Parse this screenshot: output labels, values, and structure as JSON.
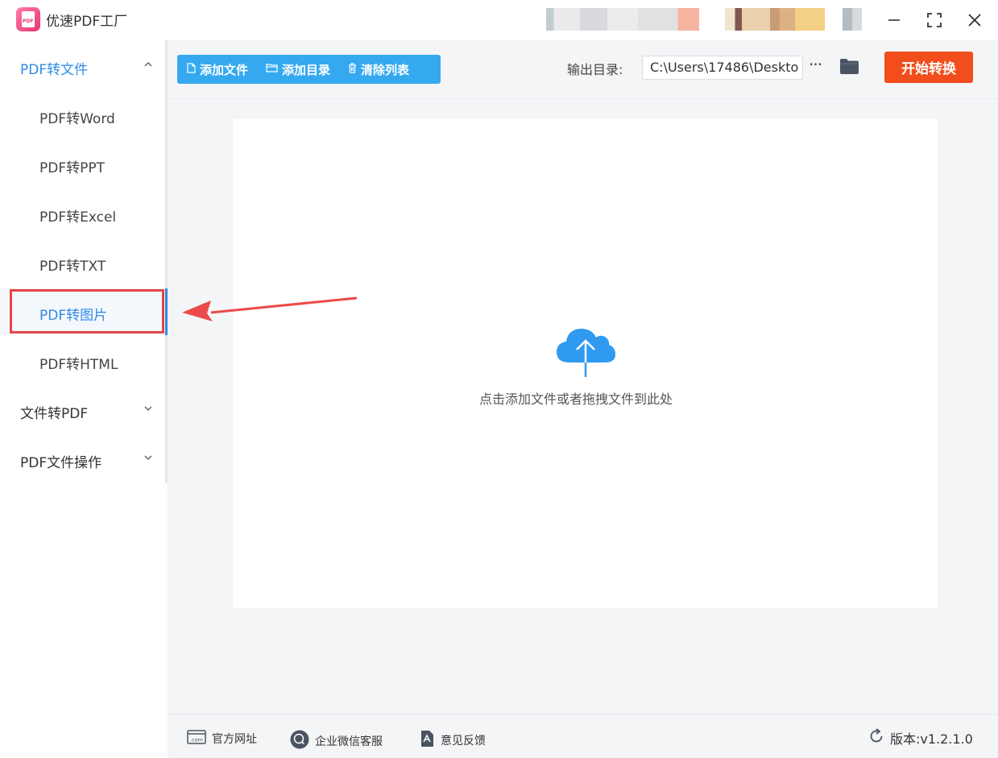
{
  "app": {
    "title": "优速PDF工厂",
    "logo_text": "PDF"
  },
  "window": {
    "controls": [
      "minimize-icon",
      "maximize-icon",
      "close-icon"
    ]
  },
  "sidebar": {
    "groups": [
      {
        "label": "PDF转文件",
        "expanded": true
      },
      {
        "label": "文件转PDF",
        "expanded": false
      },
      {
        "label": "PDF文件操作",
        "expanded": false
      }
    ],
    "items": [
      {
        "label": "PDF转Word"
      },
      {
        "label": "PDF转PPT"
      },
      {
        "label": "PDF转Excel"
      },
      {
        "label": "PDF转TXT"
      },
      {
        "label": "PDF转图片",
        "selected": true
      },
      {
        "label": "PDF转HTML"
      }
    ]
  },
  "toolbar": {
    "add_file": "添加文件",
    "add_folder": "添加目录",
    "clear_list": "清除列表"
  },
  "output": {
    "label": "输出目录:",
    "path": "C:\\Users\\17486\\Deskto"
  },
  "start_button": "开始转换",
  "drop_zone": {
    "text": "点击添加文件或者拖拽文件到此处"
  },
  "footer": {
    "website": "官方网址",
    "wechat_service": "企业微信客服",
    "feedback": "意见反馈",
    "version": "版本:v1.2.1.0"
  },
  "colors": {
    "accent_blue": "#35a9f0",
    "start_red": "#f24d1c",
    "selected_text": "#2f8ae6",
    "annotation_red": "#e84545"
  }
}
